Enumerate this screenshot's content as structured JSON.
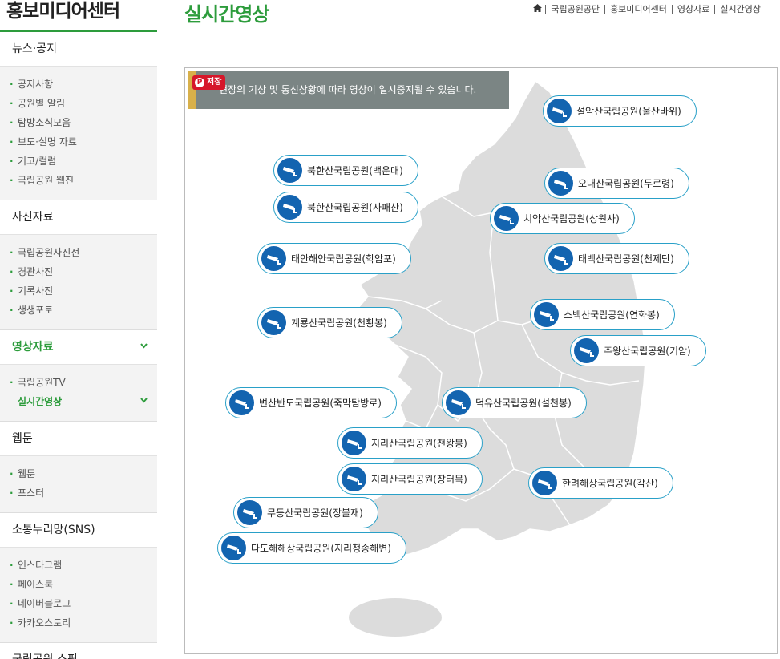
{
  "sidebar": {
    "title": "홍보미디어센터",
    "sections": [
      {
        "label": "뉴스·공지",
        "items": [
          "공지사항",
          "공원별 알림",
          "탐방소식모음",
          "보도·설명 자료",
          "기고/컬럼",
          "국립공원 웹진"
        ]
      },
      {
        "label": "사진자료",
        "items": [
          "국립공원사진전",
          "경관사진",
          "기록사진",
          "생생포토"
        ]
      },
      {
        "label": "영상자료",
        "items": [
          "국립공원TV",
          "실시간영상"
        ]
      },
      {
        "label": "웹툰",
        "items": [
          "웹툰",
          "포스터"
        ]
      },
      {
        "label": "소통누리망(SNS)",
        "items": [
          "인스타그램",
          "페이스북",
          "네이버블로그",
          "카카오스토리"
        ]
      },
      {
        "label": "국립공원 쇼핑"
      }
    ]
  },
  "header": {
    "title": "실시간영상",
    "breadcrumb": [
      "국립공원공단",
      "홍보미디어센터",
      "영상자료",
      "실시간영상"
    ]
  },
  "notice": {
    "text": "현장의 기상 및 통신상황에 따라 영상이 일시중지될 수 있습니다.",
    "save_label": "저장"
  },
  "cameras": [
    "설악산국립공원(울산바위)",
    "북한산국립공원(백운대)",
    "오대산국립공원(두로령)",
    "북한산국립공원(사패산)",
    "치악산국립공원(상원사)",
    "태안해안국립공원(학암포)",
    "태백산국립공원(천제단)",
    "소백산국립공원(연화봉)",
    "계룡산국립공원(천황봉)",
    "주왕산국립공원(기암)",
    "변산반도국립공원(죽막탐방로)",
    "덕유산국립공원(설천봉)",
    "지리산국립공원(천왕봉)",
    "지리산국립공원(장터목)",
    "한려해상국립공원(각산)",
    "무등산국립공원(장불재)",
    "다도해해상국립공원(지리청송해변)"
  ]
}
